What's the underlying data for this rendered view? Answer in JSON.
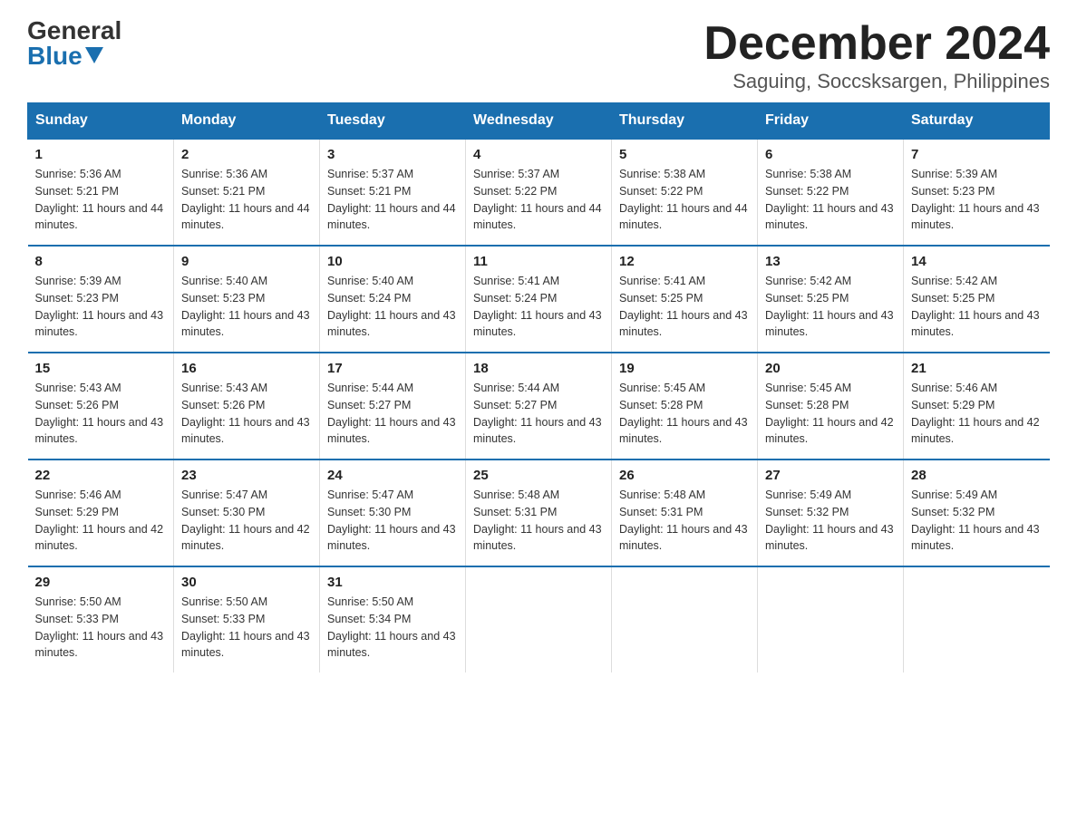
{
  "header": {
    "logo_general": "General",
    "logo_blue": "Blue",
    "title": "December 2024",
    "subtitle": "Saguing, Soccsksargen, Philippines"
  },
  "weekdays": [
    "Sunday",
    "Monday",
    "Tuesday",
    "Wednesday",
    "Thursday",
    "Friday",
    "Saturday"
  ],
  "weeks": [
    [
      {
        "day": "1",
        "sunrise": "5:36 AM",
        "sunset": "5:21 PM",
        "daylight": "11 hours and 44 minutes."
      },
      {
        "day": "2",
        "sunrise": "5:36 AM",
        "sunset": "5:21 PM",
        "daylight": "11 hours and 44 minutes."
      },
      {
        "day": "3",
        "sunrise": "5:37 AM",
        "sunset": "5:21 PM",
        "daylight": "11 hours and 44 minutes."
      },
      {
        "day": "4",
        "sunrise": "5:37 AM",
        "sunset": "5:22 PM",
        "daylight": "11 hours and 44 minutes."
      },
      {
        "day": "5",
        "sunrise": "5:38 AM",
        "sunset": "5:22 PM",
        "daylight": "11 hours and 44 minutes."
      },
      {
        "day": "6",
        "sunrise": "5:38 AM",
        "sunset": "5:22 PM",
        "daylight": "11 hours and 43 minutes."
      },
      {
        "day": "7",
        "sunrise": "5:39 AM",
        "sunset": "5:23 PM",
        "daylight": "11 hours and 43 minutes."
      }
    ],
    [
      {
        "day": "8",
        "sunrise": "5:39 AM",
        "sunset": "5:23 PM",
        "daylight": "11 hours and 43 minutes."
      },
      {
        "day": "9",
        "sunrise": "5:40 AM",
        "sunset": "5:23 PM",
        "daylight": "11 hours and 43 minutes."
      },
      {
        "day": "10",
        "sunrise": "5:40 AM",
        "sunset": "5:24 PM",
        "daylight": "11 hours and 43 minutes."
      },
      {
        "day": "11",
        "sunrise": "5:41 AM",
        "sunset": "5:24 PM",
        "daylight": "11 hours and 43 minutes."
      },
      {
        "day": "12",
        "sunrise": "5:41 AM",
        "sunset": "5:25 PM",
        "daylight": "11 hours and 43 minutes."
      },
      {
        "day": "13",
        "sunrise": "5:42 AM",
        "sunset": "5:25 PM",
        "daylight": "11 hours and 43 minutes."
      },
      {
        "day": "14",
        "sunrise": "5:42 AM",
        "sunset": "5:25 PM",
        "daylight": "11 hours and 43 minutes."
      }
    ],
    [
      {
        "day": "15",
        "sunrise": "5:43 AM",
        "sunset": "5:26 PM",
        "daylight": "11 hours and 43 minutes."
      },
      {
        "day": "16",
        "sunrise": "5:43 AM",
        "sunset": "5:26 PM",
        "daylight": "11 hours and 43 minutes."
      },
      {
        "day": "17",
        "sunrise": "5:44 AM",
        "sunset": "5:27 PM",
        "daylight": "11 hours and 43 minutes."
      },
      {
        "day": "18",
        "sunrise": "5:44 AM",
        "sunset": "5:27 PM",
        "daylight": "11 hours and 43 minutes."
      },
      {
        "day": "19",
        "sunrise": "5:45 AM",
        "sunset": "5:28 PM",
        "daylight": "11 hours and 43 minutes."
      },
      {
        "day": "20",
        "sunrise": "5:45 AM",
        "sunset": "5:28 PM",
        "daylight": "11 hours and 42 minutes."
      },
      {
        "day": "21",
        "sunrise": "5:46 AM",
        "sunset": "5:29 PM",
        "daylight": "11 hours and 42 minutes."
      }
    ],
    [
      {
        "day": "22",
        "sunrise": "5:46 AM",
        "sunset": "5:29 PM",
        "daylight": "11 hours and 42 minutes."
      },
      {
        "day": "23",
        "sunrise": "5:47 AM",
        "sunset": "5:30 PM",
        "daylight": "11 hours and 42 minutes."
      },
      {
        "day": "24",
        "sunrise": "5:47 AM",
        "sunset": "5:30 PM",
        "daylight": "11 hours and 43 minutes."
      },
      {
        "day": "25",
        "sunrise": "5:48 AM",
        "sunset": "5:31 PM",
        "daylight": "11 hours and 43 minutes."
      },
      {
        "day": "26",
        "sunrise": "5:48 AM",
        "sunset": "5:31 PM",
        "daylight": "11 hours and 43 minutes."
      },
      {
        "day": "27",
        "sunrise": "5:49 AM",
        "sunset": "5:32 PM",
        "daylight": "11 hours and 43 minutes."
      },
      {
        "day": "28",
        "sunrise": "5:49 AM",
        "sunset": "5:32 PM",
        "daylight": "11 hours and 43 minutes."
      }
    ],
    [
      {
        "day": "29",
        "sunrise": "5:50 AM",
        "sunset": "5:33 PM",
        "daylight": "11 hours and 43 minutes."
      },
      {
        "day": "30",
        "sunrise": "5:50 AM",
        "sunset": "5:33 PM",
        "daylight": "11 hours and 43 minutes."
      },
      {
        "day": "31",
        "sunrise": "5:50 AM",
        "sunset": "5:34 PM",
        "daylight": "11 hours and 43 minutes."
      },
      null,
      null,
      null,
      null
    ]
  ]
}
